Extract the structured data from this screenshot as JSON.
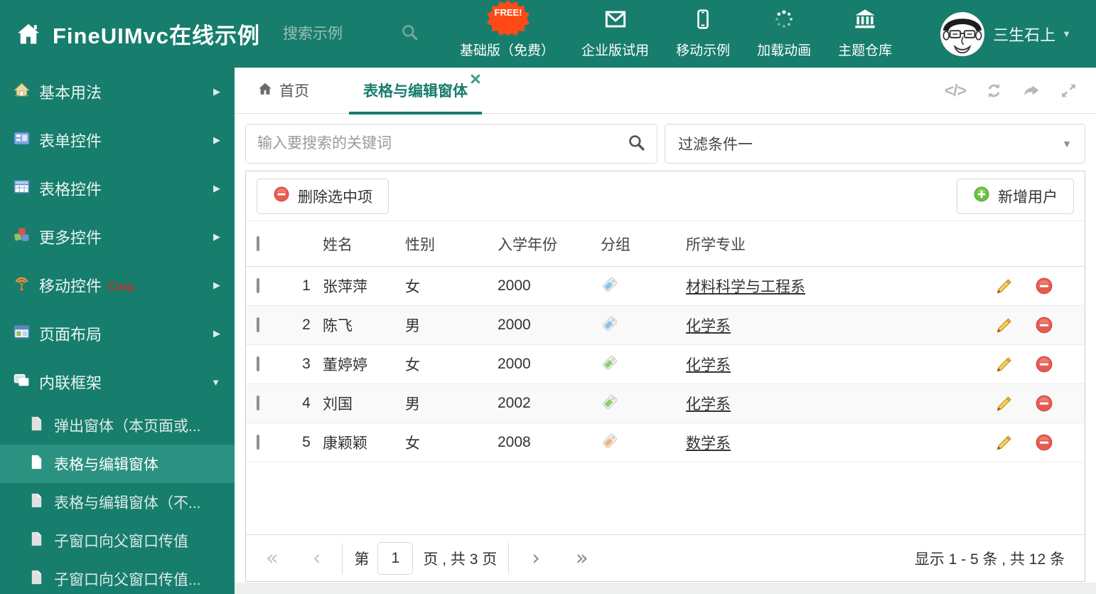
{
  "header": {
    "title": "FineUIMvc在线示例",
    "search_placeholder": "搜索示例",
    "free_badge": "FREE!",
    "nav": [
      {
        "label": "基础版（免费）",
        "icon": "download-icon"
      },
      {
        "label": "企业版试用",
        "icon": "envelope-icon"
      },
      {
        "label": "移动示例",
        "icon": "mobile-icon"
      },
      {
        "label": "加载动画",
        "icon": "spinner-icon"
      },
      {
        "label": "主题仓库",
        "icon": "bank-icon"
      }
    ],
    "username": "三生石上"
  },
  "sidebar": {
    "items": [
      {
        "label": "基本用法",
        "icon": "house-icon"
      },
      {
        "label": "表单控件",
        "icon": "form-icon"
      },
      {
        "label": "表格控件",
        "icon": "grid-icon"
      },
      {
        "label": "更多控件",
        "icon": "cubes-icon"
      },
      {
        "label": "移动控件",
        "badge": "Corp.",
        "icon": "antenna-icon"
      },
      {
        "label": "页面布局",
        "icon": "layout-icon"
      },
      {
        "label": "内联框架",
        "icon": "frames-icon"
      }
    ],
    "subitems": [
      {
        "label": "弹出窗体（本页面或..."
      },
      {
        "label": "表格与编辑窗体",
        "selected": true
      },
      {
        "label": "表格与编辑窗体（不..."
      },
      {
        "label": "子窗口向父窗口传值"
      },
      {
        "label": "子窗口向父窗口传值..."
      }
    ]
  },
  "tabs": {
    "home": "首页",
    "active": "表格与编辑窗体"
  },
  "filters": {
    "search_placeholder": "输入要搜索的关键词",
    "dropdown_value": "过滤条件一"
  },
  "toolbar": {
    "delete_label": "删除选中项",
    "add_label": "新增用户"
  },
  "table": {
    "columns": [
      "姓名",
      "性别",
      "入学年份",
      "分组",
      "所学专业"
    ],
    "rows": [
      {
        "num": "1",
        "name": "张萍萍",
        "gender": "女",
        "year": "2000",
        "tag_color": "#85c4ee",
        "major": "材料科学与工程系"
      },
      {
        "num": "2",
        "name": "陈飞",
        "gender": "男",
        "year": "2000",
        "tag_color": "#85c4ee",
        "major": "化学系"
      },
      {
        "num": "3",
        "name": "董婷婷",
        "gender": "女",
        "year": "2000",
        "tag_color": "#8fce6f",
        "major": "化学系"
      },
      {
        "num": "4",
        "name": "刘国",
        "gender": "男",
        "year": "2002",
        "tag_color": "#8fce6f",
        "major": "化学系"
      },
      {
        "num": "5",
        "name": "康颖颖",
        "gender": "女",
        "year": "2008",
        "tag_color": "#f8b26a",
        "major": "数学系"
      }
    ]
  },
  "pagination": {
    "page_prefix": "第",
    "page_value": "1",
    "page_suffix": "页 , 共 3 页",
    "summary": "显示 1 - 5 条 , 共 12 条"
  },
  "colors": {
    "theme": "#177d6c",
    "theme_selected": "#2b9181",
    "free_badge_orange": "#ff4a17",
    "corp_red": "#ff1a1a",
    "delete_red": "#e85a50",
    "add_green": "#6cbf3f",
    "tag_blue": "#85c4ee",
    "tag_green": "#8fce6f",
    "tag_orange": "#f8b26a",
    "edit_gold": "#f7d358"
  }
}
